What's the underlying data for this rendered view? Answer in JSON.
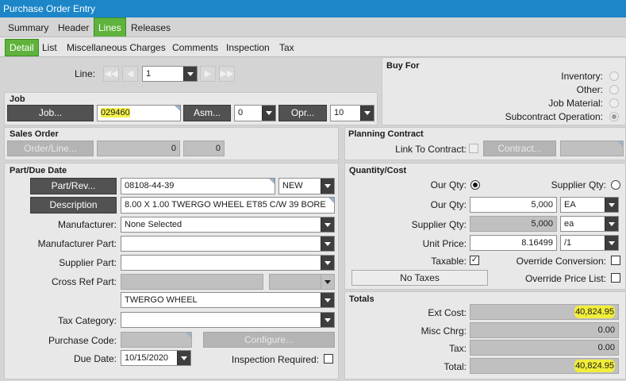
{
  "window": {
    "title": "Purchase Order Entry"
  },
  "tabs": [
    {
      "label": "Summary",
      "active": false
    },
    {
      "label": "Header",
      "active": false
    },
    {
      "label": "Lines",
      "active": true
    },
    {
      "label": "Releases",
      "active": false
    }
  ],
  "subtabs": [
    {
      "label": "Detail",
      "active": true
    },
    {
      "label": "List",
      "active": false
    },
    {
      "label": "Miscellaneous Charges",
      "active": false
    },
    {
      "label": "Comments",
      "active": false
    },
    {
      "label": "Inspection",
      "active": false
    },
    {
      "label": "Tax",
      "active": false
    }
  ],
  "line": {
    "label": "Line:",
    "value": "1"
  },
  "job": {
    "title": "Job",
    "job_button": "Job...",
    "job_value": "029460",
    "asm_button": "Asm...",
    "asm_value": "0",
    "opr_button": "Opr...",
    "opr_value": "10"
  },
  "sales_order": {
    "title": "Sales Order",
    "button": "Order/Line...",
    "order_value": "0",
    "line_value": "0"
  },
  "part": {
    "title": "Part/Due Date",
    "part_button": "Part/Rev...",
    "part_value": "08108-44-39",
    "rev_value": "NEW",
    "desc_button": "Description",
    "desc_value": "8.00 X 1.00 TWERGO WHEEL ET85 C/W 39 BORE",
    "manufacturer_label": "Manufacturer:",
    "manufacturer_value": "None Selected",
    "manufacturer_part_label": "Manufacturer Part:",
    "manufacturer_part_value": "",
    "supplier_part_label": "Supplier Part:",
    "supplier_part_value": "",
    "cross_ref_label": "Cross Ref Part:",
    "cross_ref_desc_value": "TWERGO WHEEL",
    "tax_category_label": "Tax Category:",
    "tax_category_value": "",
    "purchase_code_label": "Purchase Code:",
    "configure_button": "Configure...",
    "due_date_label": "Due Date:",
    "due_date_value": "10/15/2020",
    "inspection_label": "Inspection Required:"
  },
  "buy_for": {
    "title": "Buy For",
    "options": [
      {
        "label": "Inventory:",
        "selected": false
      },
      {
        "label": "Other:",
        "selected": false
      },
      {
        "label": "Job Material:",
        "selected": false
      },
      {
        "label": "Subcontract Operation:",
        "selected": true
      }
    ]
  },
  "planning": {
    "title": "Planning Contract",
    "link_label": "Link To Contract:",
    "contract_button": "Contract..."
  },
  "quantity": {
    "title": "Quantity/Cost",
    "our_qty_radio_label": "Our Qty:",
    "supplier_qty_radio_label": "Supplier Qty:",
    "our_qty_label": "Our Qty:",
    "our_qty_value": "5,000",
    "our_uom": "EA",
    "supplier_qty_label": "Supplier Qty:",
    "supplier_qty_value": "5,000",
    "supplier_uom": "ea",
    "unit_price_label": "Unit Price:",
    "unit_price_value": "8.16499",
    "price_per": "/1",
    "taxable_label": "Taxable:",
    "override_conversion_label": "Override Conversion:",
    "no_taxes_button": "No Taxes",
    "override_price_label": "Override Price List:"
  },
  "totals": {
    "title": "Totals",
    "ext_cost_label": "Ext Cost:",
    "ext_cost_value": "40,824.95",
    "misc_label": "Misc Chrg:",
    "misc_value": "0.00",
    "tax_label": "Tax:",
    "tax_value": "0.00",
    "total_label": "Total:",
    "total_value": "40,824.95"
  },
  "colors": {
    "titlebar": "#1c86c8",
    "active_tab": "#5fb33c",
    "button_dark": "#525252",
    "highlight": "#f1ee3a"
  }
}
